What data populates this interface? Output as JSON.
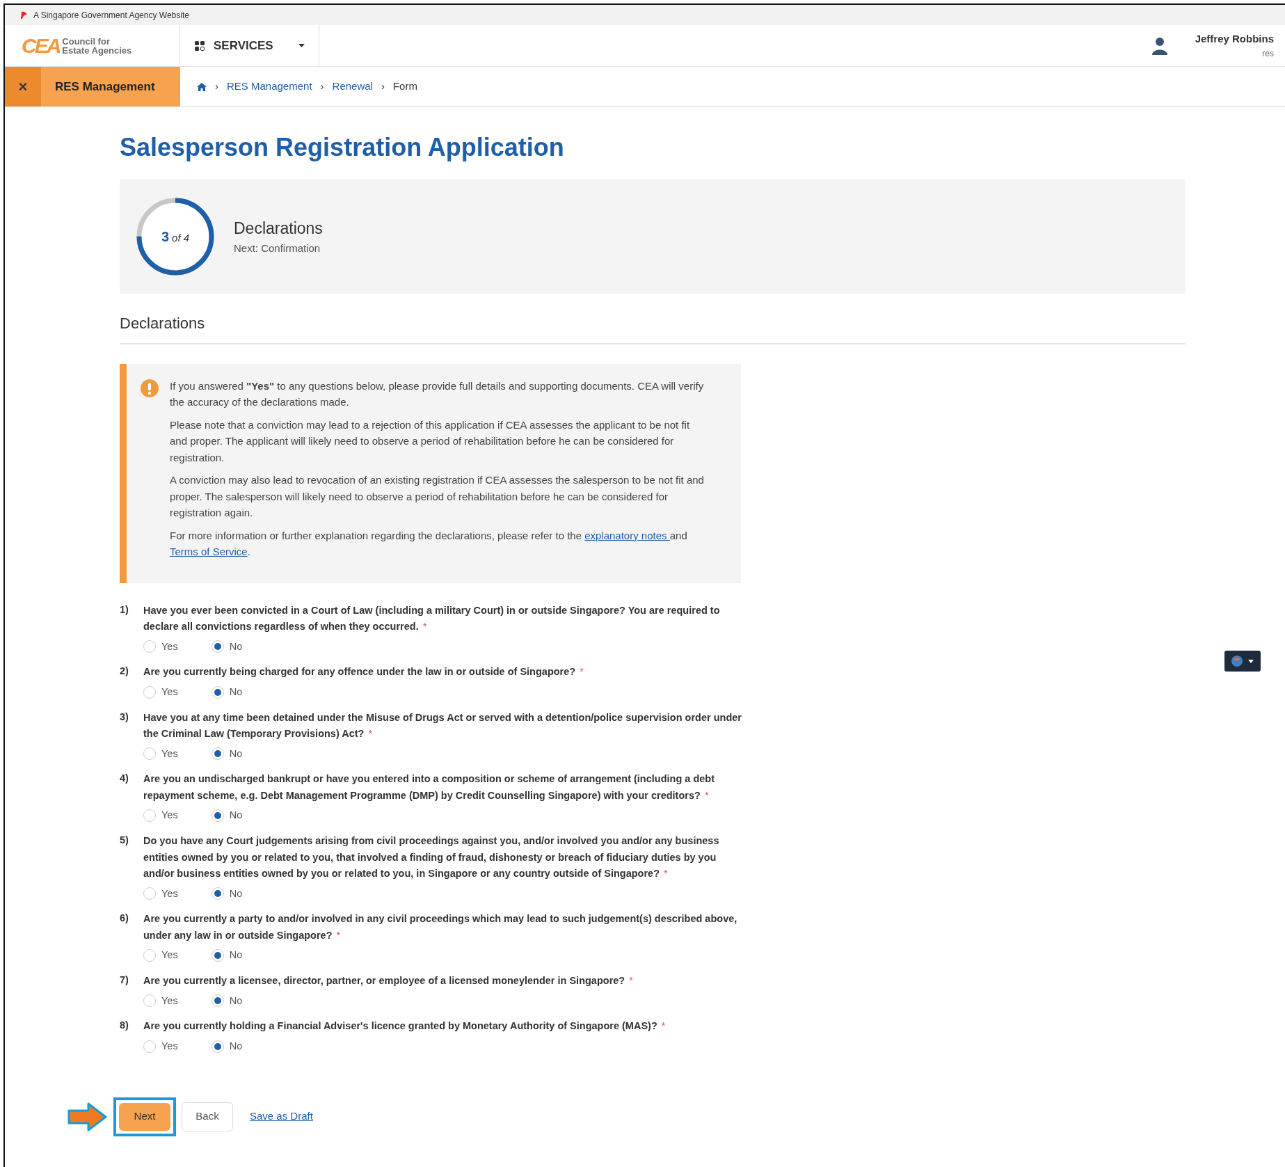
{
  "gov_banner": {
    "text": "A Singapore Government Agency Website"
  },
  "header": {
    "logo_mark": "CEA",
    "logo_text_1": "Council for",
    "logo_text_2": "Estate Agencies",
    "services_label": "SERVICES",
    "user_name": "Jeffrey Robbins",
    "user_role": "res"
  },
  "subbar": {
    "close_glyph": "×",
    "module": "RES Management",
    "breadcrumbs": [
      {
        "label": "RES Management",
        "link": true
      },
      {
        "label": "Renewal",
        "link": true
      },
      {
        "label": "Form",
        "link": false
      }
    ],
    "breadcrumb_separator": "›"
  },
  "title": "Salesperson Registration Application",
  "progress": {
    "step": "3",
    "of_text": "of 4",
    "level": 0.75,
    "step_title": "Declarations",
    "next": "Next: Confirmation"
  },
  "section_heading": "Declarations",
  "notice": {
    "paragraphs": [
      "If you answered **\"Yes\"** to any questions below, please provide full details and supporting documents. CEA will verify the accuracy of the declarations made.",
      "Please note that a conviction may lead to a rejection of this application if CEA assesses the applicant to be not fit and proper. The applicant will likely need to observe a period of rehabilitation before he can be considered for registration.",
      "A conviction may also lead to revocation of an existing registration if CEA assesses the salesperson to be not fit and proper. The salesperson will likely need to observe a period of rehabilitation before he can be considered for registration again."
    ],
    "last": [
      {
        "kind": "text",
        "text": "For more information or further explanation regarding the declarations, please refer to the "
      },
      {
        "kind": "link",
        "text": "explanatory notes "
      },
      {
        "kind": "text",
        "text": "and "
      },
      {
        "kind": "link",
        "text": "Terms of Service"
      },
      {
        "kind": "text",
        "text": "."
      }
    ]
  },
  "questions": [
    {
      "number": "1)",
      "text": "Have you ever been convicted in a Court of Law (including a military Court) in or outside Singapore? You are required to declare all convictions regardless of when they occurred.",
      "required": "*",
      "options": [
        {
          "label": "Yes",
          "selected": false
        },
        {
          "label": "No",
          "selected": true
        }
      ]
    },
    {
      "number": "2)",
      "text": "Are you currently being charged for any offence under the law in or outside of Singapore?",
      "required": "*",
      "options": [
        {
          "label": "Yes",
          "selected": false
        },
        {
          "label": "No",
          "selected": true
        }
      ]
    },
    {
      "number": "3)",
      "text": "Have you at any time been detained under the Misuse of Drugs Act or served with a detention/police supervision order under the Criminal Law (Temporary Provisions) Act?",
      "required": "*",
      "options": [
        {
          "label": "Yes",
          "selected": false
        },
        {
          "label": "No",
          "selected": true
        }
      ]
    },
    {
      "number": "4)",
      "text": "Are you an undischarged bankrupt or have you entered into a composition or scheme of arrangement (including a debt repayment scheme, e.g. Debt Management Programme (DMP) by Credit Counselling Singapore) with your creditors?",
      "required": "*",
      "options": [
        {
          "label": "Yes",
          "selected": false
        },
        {
          "label": "No",
          "selected": true
        }
      ]
    },
    {
      "number": "5)",
      "text": "Do you have any Court judgements arising from civil proceedings against you, and/or involved you and/or any business entities owned by you or related to you, that involved a finding of fraud, dishonesty or breach of fiduciary duties by you and/or business entities owned by you or related to you, in Singapore or any country outside of Singapore?",
      "required": "*",
      "options": [
        {
          "label": "Yes",
          "selected": false
        },
        {
          "label": "No",
          "selected": true
        }
      ]
    },
    {
      "number": "6)",
      "text": "Are you currently a party to and/or involved in any civil proceedings which may lead to such judgement(s) described above, under any law in or outside Singapore?",
      "required": "*",
      "options": [
        {
          "label": "Yes",
          "selected": false
        },
        {
          "label": "No",
          "selected": true
        }
      ]
    },
    {
      "number": "7)",
      "text": "Are you currently a licensee, director, partner, or employee of a licensed moneylender in Singapore?",
      "required": "*",
      "options": [
        {
          "label": "Yes",
          "selected": false
        },
        {
          "label": "No",
          "selected": true
        }
      ]
    },
    {
      "number": "8)",
      "text": "Are you currently holding a Financial Adviser's licence granted by Monetary Authority of Singapore (MAS)?",
      "required": "*",
      "options": [
        {
          "label": "Yes",
          "selected": false
        },
        {
          "label": "No",
          "selected": true
        }
      ]
    }
  ],
  "actions": {
    "next": "Next",
    "back": "Back",
    "draft": "Save as Draft",
    "next_highlighted": true
  }
}
